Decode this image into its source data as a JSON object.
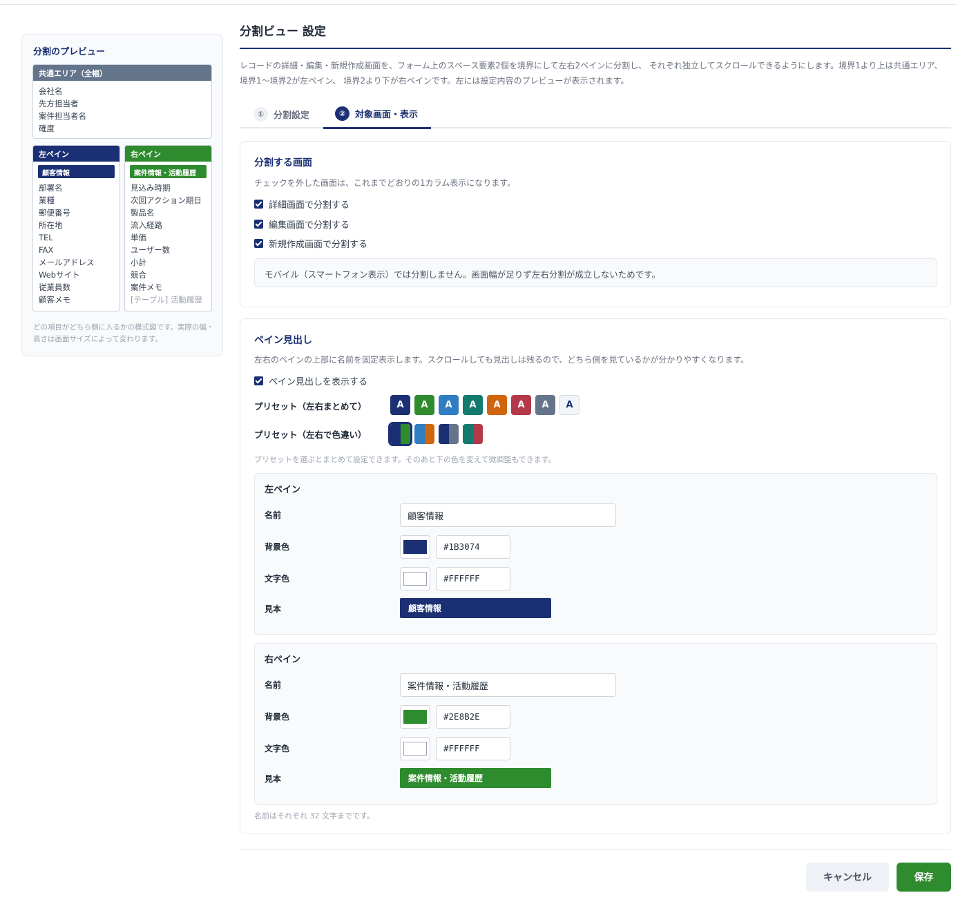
{
  "preview": {
    "title": "分割のプレビュー",
    "common_header": "共通エリア（全幅）",
    "common_fields": [
      "会社名",
      "先方担当者",
      "案件担当者名",
      "確度"
    ],
    "left_header": "左ペイン",
    "left_badge": "顧客情報",
    "left_fields": [
      "部署名",
      "業種",
      "郵便番号",
      "所在地",
      "TEL",
      "FAX",
      "メールアドレス",
      "Webサイト",
      "従業員数",
      "顧客メモ"
    ],
    "right_header": "右ペイン",
    "right_badge": "案件情報・活動履歴",
    "right_fields": [
      "見込み時期",
      "次回アクション期日",
      "製品名",
      "流入経路",
      "単価",
      "ユーザー数",
      "小計",
      "競合",
      "案件メモ"
    ],
    "right_table_field": "[テーブル] 活動履歴",
    "note": "どの項目がどちら側に入るかの模式図です。実際の幅・高さは画面サイズによって変わります。"
  },
  "page": {
    "title": "分割ビュー 設定",
    "intro": "レコードの詳細・編集・新規作成画面を、フォーム上のスペース要素2個を境界にして左右2ペインに分割し、 それぞれ独立してスクロールできるようにします。境界1より上は共通エリア、境界1〜境界2が左ペイン、 境界2より下が右ペインです。左には設定内容のプレビューが表示されます。"
  },
  "tabs": [
    {
      "num": "①",
      "label": "分割設定"
    },
    {
      "num": "②",
      "label": "対象画面・表示"
    }
  ],
  "split_screens": {
    "title": "分割する画面",
    "desc": "チェックを外した画面は、これまでどおりの1カラム表示になります。",
    "options": [
      "詳細画面で分割する",
      "編集画面で分割する",
      "新規作成画面で分割する"
    ],
    "notice": "モバイル（スマートフォン表示）では分割しません。画面幅が足りず左右分割が成立しないためです。"
  },
  "pane_heading": {
    "title": "ペイン見出し",
    "desc": "左右のペインの上部に名前を固定表示します。スクロールしても見出しは残るので、どちら側を見ているかが分かりやすくなります。",
    "show_label": "ペイン見出しを表示する",
    "preset_uniform_label": "プリセット（左右まとめて）",
    "preset_uniform_letter": "A",
    "preset_uniform_colors": [
      "#1B3074",
      "#2E8B2E",
      "#2F7DC2",
      "#137A6E",
      "#D0650F",
      "#B2384A",
      "#64748B",
      "#F1F5F9"
    ],
    "preset_dual_label": "プリセット（左右で色違い）",
    "preset_dual_colors": [
      [
        "#1B3074",
        "#2E8B2E"
      ],
      [
        "#2F7DC2",
        "#D0650F"
      ],
      [
        "#1B3074",
        "#64748B"
      ],
      [
        "#137A6E",
        "#B2384A"
      ]
    ],
    "preset_note": "プリセットを選ぶとまとめて設定できます。そのあと下の色を変えて微調整もできます。",
    "footer_note": "名前はそれぞれ 32 文字までです。"
  },
  "left_pane": {
    "title": "左ペイン",
    "name_label": "名前",
    "name_value": "顧客情報",
    "bg_label": "背景色",
    "bg_value": "#1B3074",
    "text_label": "文字色",
    "text_value": "#FFFFFF",
    "sample_label": "見本",
    "sample_text": "顧客情報"
  },
  "right_pane": {
    "title": "右ペイン",
    "name_label": "名前",
    "name_value": "案件情報・活動履歴",
    "bg_label": "背景色",
    "bg_value": "#2E8B2E",
    "text_label": "文字色",
    "text_value": "#FFFFFF",
    "sample_label": "見本",
    "sample_text": "案件情報・活動履歴"
  },
  "buttons": {
    "cancel": "キャンセル",
    "save": "保存"
  }
}
